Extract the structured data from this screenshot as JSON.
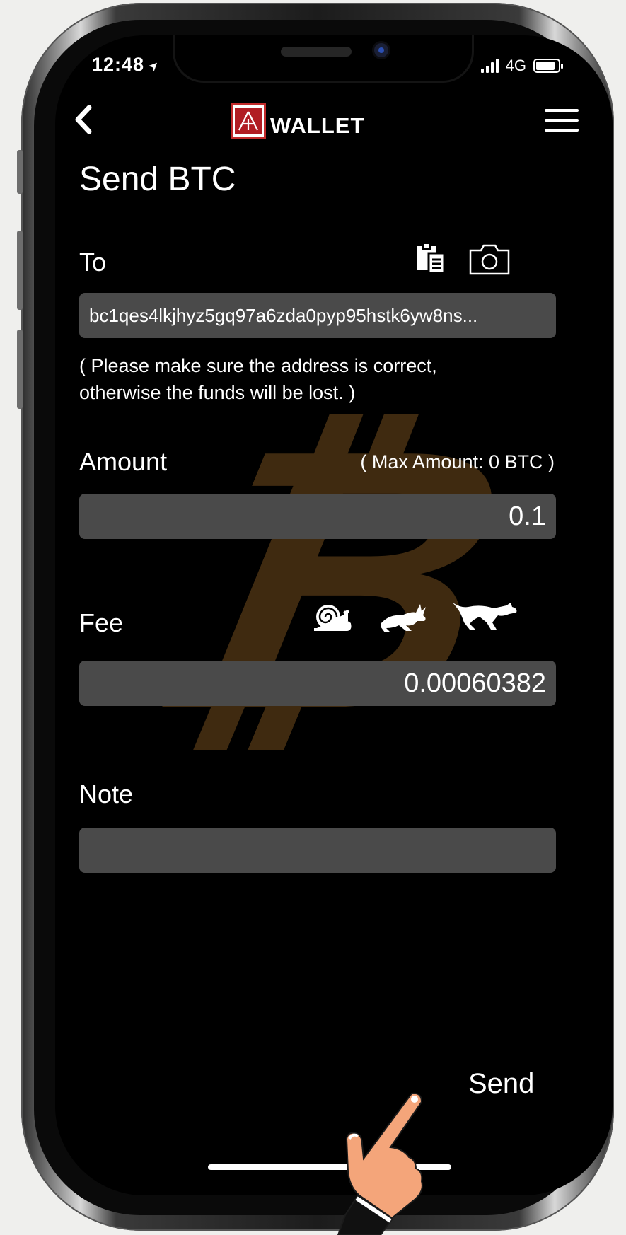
{
  "status_bar": {
    "time": "12:48",
    "location_glyph": "➤",
    "network": "4G"
  },
  "header": {
    "logo_text": "WALLET",
    "logo_mark": "A"
  },
  "page": {
    "title": "Send BTC"
  },
  "to_section": {
    "label": "To",
    "address": "bc1qes4lkjhyz5gq97a6zda0pyp95hstk6yw8ns...",
    "warning_line1": "( Please make sure the address is correct,",
    "warning_line2": "otherwise the funds will be lost. )",
    "icons": [
      "clipboard-paste-icon",
      "camera-icon"
    ]
  },
  "amount_section": {
    "label": "Amount",
    "max_amount": "( Max Amount: 0 BTC )",
    "value": "0.1"
  },
  "fee_section": {
    "label": "Fee",
    "value": "0.00060382",
    "icons": [
      "snail-icon",
      "rabbit-icon",
      "cheetah-icon"
    ]
  },
  "note_section": {
    "label": "Note",
    "value": ""
  },
  "actions": {
    "send_label": "Send"
  },
  "colors": {
    "field_bg": "#4a4a4a",
    "screen_bg": "#000000",
    "btc_watermark": "#3f2a10",
    "logo_red": "#b11d23"
  }
}
